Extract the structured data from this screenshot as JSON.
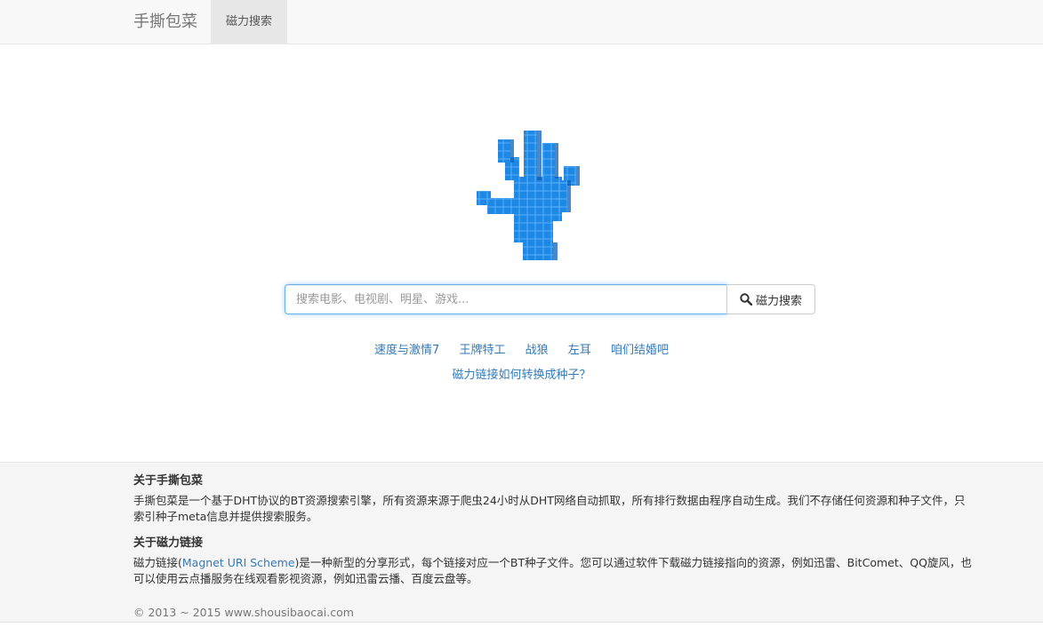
{
  "navbar": {
    "brand": "手撕包菜",
    "tab_label": "磁力搜索"
  },
  "logo": {
    "icon": "pixel-hand-icon",
    "color": "#1e88e5"
  },
  "search": {
    "placeholder": "搜索电影、电视剧、明星、游戏...",
    "value": "",
    "button_label": "磁力搜索",
    "button_icon": "search-icon"
  },
  "hot_links": [
    "速度与激情7",
    "王牌特工",
    "战狼",
    "左耳",
    "咱们结婚吧"
  ],
  "howto_link": "磁力链接如何转换成种子？",
  "footer": {
    "about_title": "关于手撕包菜",
    "about_text": "手撕包菜是一个基于DHT协议的BT资源搜索引擎，所有资源来源于爬虫24小时从DHT网络自动抓取，所有排行数据由程序自动生成。我们不存储任何资源和种子文件，只索引种子meta信息并提供搜索服务。",
    "magnet_title": "关于磁力链接",
    "magnet_text_pre": "磁力链接(",
    "magnet_link": "Magnet URI Scheme",
    "magnet_text_post": ")是一种新型的分享形式，每个链接对应一个BT种子文件。您可以通过软件下载磁力链接指向的资源，例如迅雷、BitComet、QQ旋风，也可以使用云点播服务在线观看影视资源，例如迅雷云播、百度云盘等。",
    "copyright": "© 2013 ~ 2015 www.shousibaocai.com"
  },
  "colors": {
    "link": "#337ab7",
    "navbar_bg": "#f8f8f8",
    "footer_bg": "#f5f5f5",
    "input_focus": "#66afe9"
  }
}
